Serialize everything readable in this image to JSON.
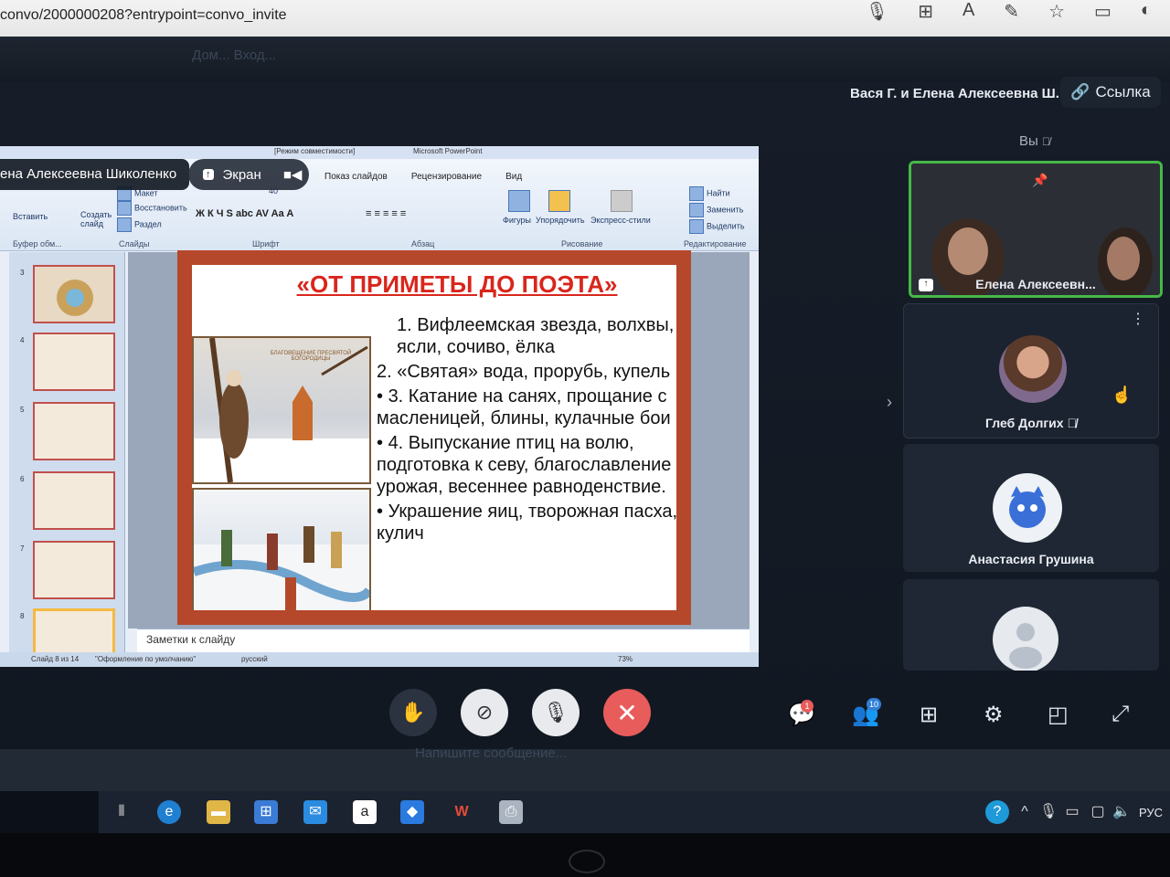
{
  "browser": {
    "url": "convo/2000000208?entrypoint=convo_invite",
    "icons": [
      "mic-icon",
      "extensions-icon",
      "read-aloud-icon",
      "edit-icon",
      "favorite-icon",
      "collections-icon",
      "profile-icon"
    ]
  },
  "header": {
    "ghost_title": "Дом... Вход...",
    "call_title": "Вася Г. и Елена Алексеевна Ш.",
    "link_label": "Ссылка",
    "you_label": "Вы"
  },
  "screen_share": {
    "presenter_name": "ена Алексеевна Шиколенко",
    "screen_chip_label": "Экран",
    "powerpoint": {
      "title_bar": "Microsoft PowerPoint",
      "compat_mode": "[Режим совместимости]",
      "tabs": [
        "Показ слайдов",
        "Рецензирование",
        "Вид"
      ],
      "groups": [
        "Буфер обм...",
        "Слайды",
        "Шрифт",
        "Абзац",
        "Рисование",
        "Редактирование"
      ],
      "ribbon_buttons": {
        "paste": "Вставить",
        "new_slide": "Создать слайд",
        "layout": "Макет",
        "restore": "Восстановить",
        "section": "Раздел",
        "font_size": "40",
        "shapes": "Фигуры",
        "arrange": "Упорядочить",
        "quick_styles": "Экспресс-стили",
        "find": "Найти",
        "replace": "Заменить",
        "select": "Выделить"
      },
      "thumbnail_numbers": [
        "3",
        "4",
        "5",
        "6",
        "7",
        "8"
      ],
      "slide": {
        "title": "«ОТ ПРИМЕТЫ ДО ПОЭТА»",
        "picture_caption": "БЛАГОВЕЩЕНИЕ ПРЕСВЯТОЙ БОГОРОДИЦЫ",
        "lines": [
          "1.  Вифлеемская звезда, волхвы, ясли, сочиво, ёлка",
          "2.  «Святая» вода, прорубь, купель",
          "3. Катание на санях, прощание с масленицей, блины, кулачные бои",
          "4. Выпускание птиц на волю, подготовка к севу, благославление урожая, весеннее равноденствие.",
          "Украшение яиц, творожная пасха, кулич"
        ]
      },
      "notes_placeholder": "Заметки к слайду",
      "status": {
        "slide_of": "Слайд 8 из 14",
        "theme": "\"Оформление по умолчанию\"",
        "language": "русский",
        "zoom": "73%"
      }
    }
  },
  "participants": [
    {
      "name": "Елена Алексеевн...",
      "video": true,
      "pinned": true
    },
    {
      "name": "Глеб Долгих",
      "muted": true
    },
    {
      "name": "Анастасия Грушина"
    },
    {
      "name": ""
    }
  ],
  "controls": {
    "raise_hand": "raise-hand-icon",
    "camera": "camera-off-icon",
    "microphone": "mic-off-icon",
    "end_call": "end-call-icon",
    "chat_badge": "1",
    "participants_badge": "10",
    "icons": [
      "chat-icon",
      "participants-icon",
      "grid-icon",
      "settings-icon",
      "layout-icon",
      "fullscreen-icon"
    ]
  },
  "chat_ghost": {
    "placeholder": "Напишите сообщение..."
  },
  "taskbar": {
    "lang": "РУС",
    "apps": [
      "task-view-icon",
      "edge-icon",
      "explorer-icon",
      "store-icon",
      "mail-icon",
      "amazon-icon",
      "dropbox-icon",
      "wps-icon",
      "printer-icon"
    ]
  },
  "colors": {
    "slide_title": "#d9261c",
    "active_speaker_border": "#46b848",
    "end_call": "#e85c5c",
    "background": "#121822"
  }
}
